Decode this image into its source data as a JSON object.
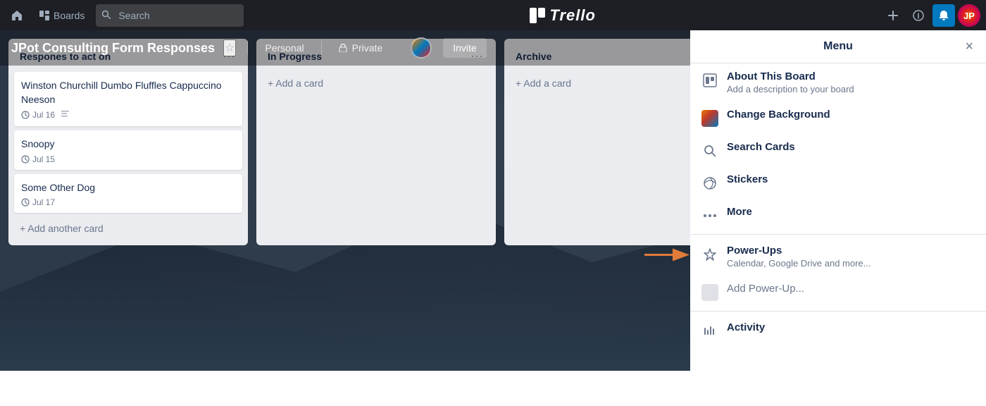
{
  "topNav": {
    "homeIcon": "🏠",
    "boardsLabel": "Boards",
    "searchPlaceholder": "Search",
    "logoText": "Trello",
    "plusLabel": "+",
    "infoIcon": "ℹ",
    "bellIcon": "🔔",
    "avatarInitials": "JP"
  },
  "boardHeader": {
    "title": "JPot Consulting Form Responses",
    "starIcon": "☆",
    "visibility": "Personal",
    "privacy": "Private",
    "inviteLabel": "Invite"
  },
  "lists": [
    {
      "id": "list1",
      "title": "Respones to act on",
      "cards": [
        {
          "id": "card1",
          "title": "Winston Churchill Dumbo Fluffles Cappuccino Neeson",
          "dueDate": "Jul 16",
          "hasDesc": true
        },
        {
          "id": "card2",
          "title": "Snoopy",
          "dueDate": "Jul 15",
          "hasDesc": false
        },
        {
          "id": "card3",
          "title": "Some Other Dog",
          "dueDate": "Jul 17",
          "hasDesc": false
        }
      ],
      "addCardLabel": "+ Add another card"
    },
    {
      "id": "list2",
      "title": "In Progress",
      "cards": [],
      "addCardLabel": "+ Add a card"
    },
    {
      "id": "list3",
      "title": "Archive",
      "cards": [],
      "addCardLabel": "+ Add a card"
    }
  ],
  "menu": {
    "title": "Menu",
    "closeIcon": "×",
    "items": [
      {
        "id": "about",
        "icon": "board",
        "label": "About This Board",
        "sublabel": "Add a description to your board"
      },
      {
        "id": "change-bg",
        "icon": "gradient",
        "label": "Change Background",
        "sublabel": ""
      },
      {
        "id": "search-cards",
        "icon": "search",
        "label": "Search Cards",
        "sublabel": ""
      },
      {
        "id": "stickers",
        "icon": "sticker",
        "label": "Stickers",
        "sublabel": ""
      },
      {
        "id": "more",
        "icon": "dots",
        "label": "More",
        "sublabel": ""
      }
    ],
    "powerups": {
      "label": "Power-Ups",
      "sublabel": "Calendar, Google Drive and more...",
      "addLabel": "Add Power-Up..."
    },
    "activity": {
      "label": "Activity"
    }
  }
}
